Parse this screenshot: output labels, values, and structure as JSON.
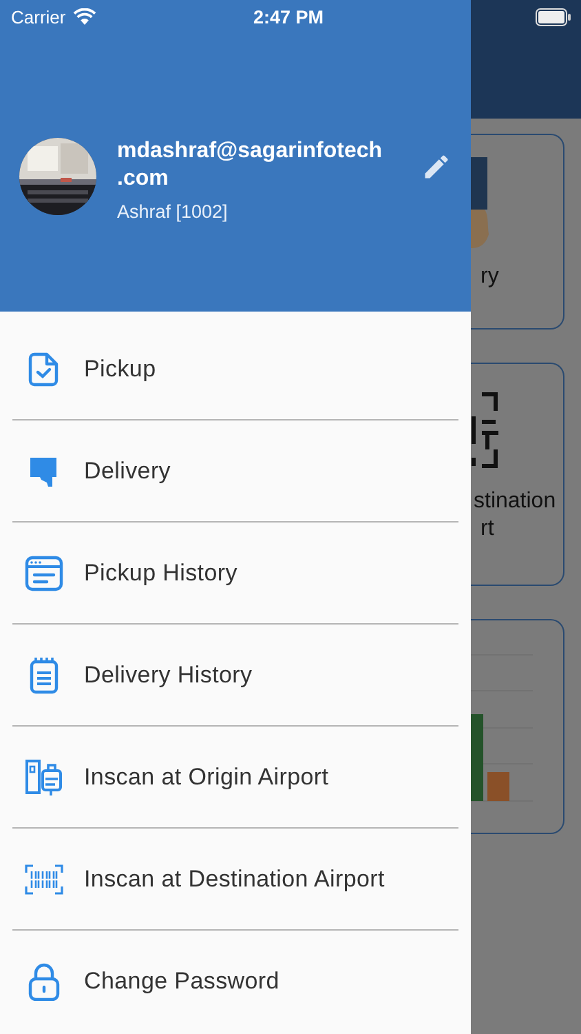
{
  "status_bar": {
    "carrier": "Carrier",
    "time": "2:47 PM"
  },
  "profile": {
    "email": "mdashraf@sagarinfotech.com",
    "name": "Ashraf [1002]"
  },
  "menu": [
    {
      "label": "Pickup"
    },
    {
      "label": "Delivery"
    },
    {
      "label": "Pickup History"
    },
    {
      "label": "Delivery History"
    },
    {
      "label": "Inscan at Origin Airport"
    },
    {
      "label": "Inscan at Destination Airport"
    },
    {
      "label": "Change Password"
    }
  ],
  "background_cards": [
    {
      "kind": "figure",
      "lines": [
        "ry"
      ]
    },
    {
      "kind": "scanner",
      "lines": [
        "stination",
        "rt"
      ]
    },
    {
      "kind": "chart"
    }
  ]
}
